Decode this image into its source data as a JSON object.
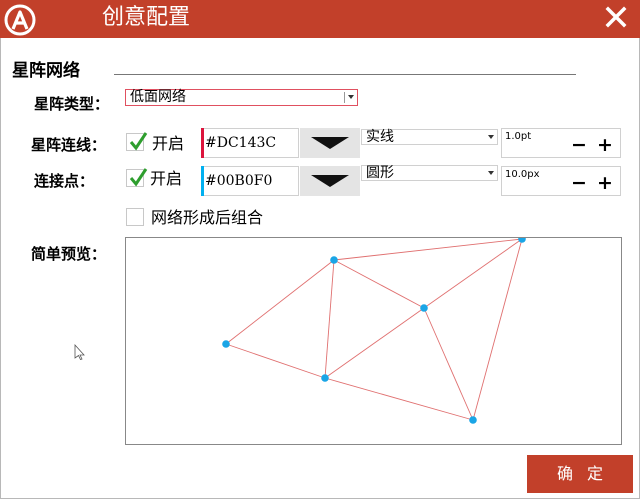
{
  "window": {
    "title": "创意配置",
    "accent_color": "#c2402a"
  },
  "section": {
    "title": "星阵网络"
  },
  "rows": {
    "type": {
      "label": "星阵类型：",
      "value": "低面网络"
    },
    "lines": {
      "label": "星阵连线：",
      "enabled_label": "开启",
      "enabled": true,
      "color": "#DC143C",
      "style": "实线",
      "width": "1.0pt"
    },
    "points": {
      "label": "连接点：",
      "enabled_label": "开启",
      "enabled": true,
      "color": "#00B0F0",
      "shape": "圆形",
      "size": "10.0px"
    }
  },
  "group_after": {
    "label": "网络形成后组合",
    "checked": false
  },
  "preview": {
    "label": "简单预览："
  },
  "buttons": {
    "minus": "−",
    "plus": "+",
    "ok": "确定"
  },
  "icons": {
    "logo": "app-logo-icon",
    "close": "close-icon",
    "check": "checkmark-icon",
    "cursor": "cursor-icon"
  }
}
